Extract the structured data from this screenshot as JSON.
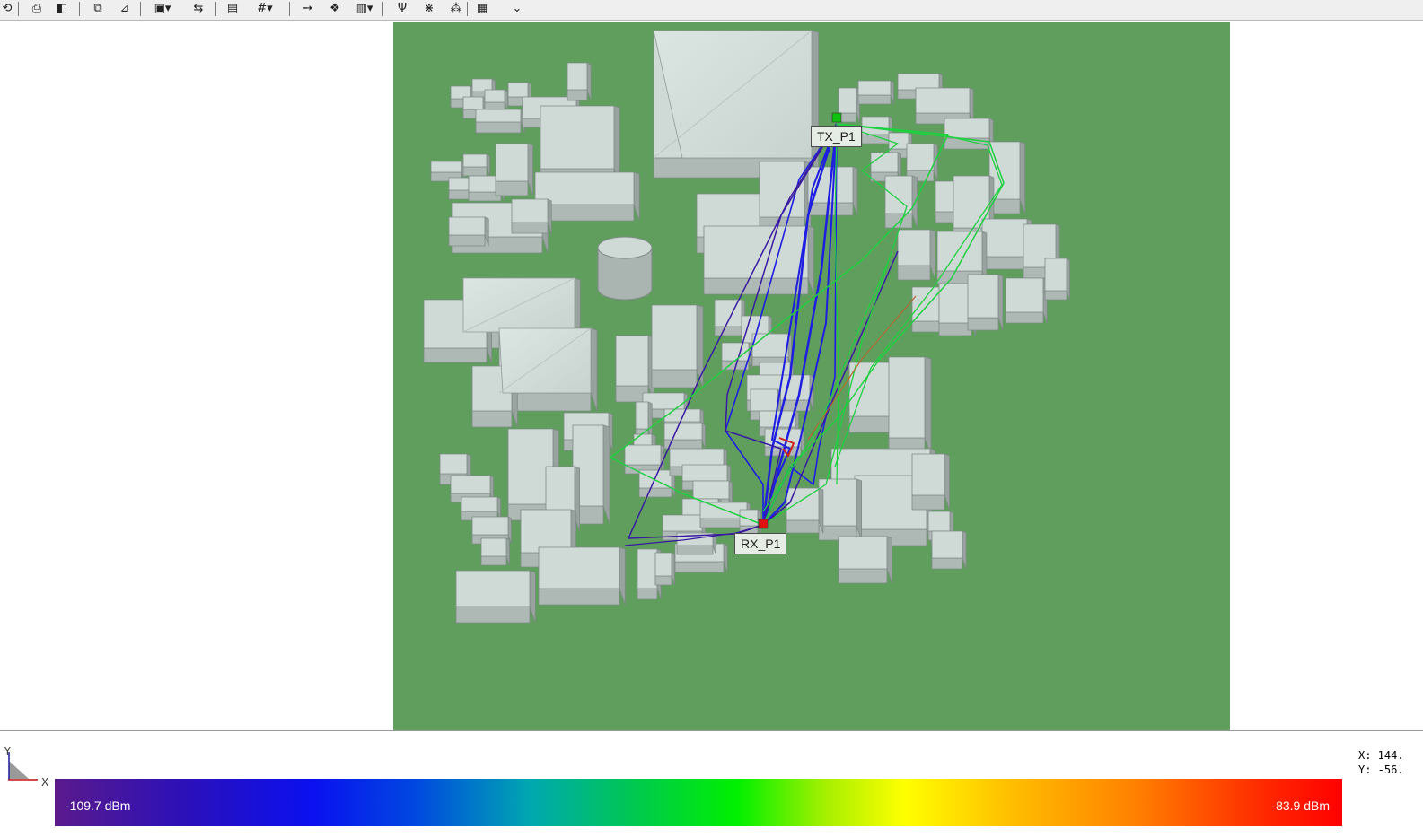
{
  "toolbar": {
    "buttons": [
      {
        "name": "rotate-view-icon",
        "glyph": "⟲"
      },
      {
        "name": "print-icon",
        "glyph": "⎙"
      },
      {
        "name": "solid-shading-icon",
        "glyph": "◧"
      },
      {
        "name": "copy-view-icon",
        "glyph": "⧉"
      },
      {
        "name": "edit-view-icon",
        "glyph": "⊿"
      },
      {
        "name": "capture-dropdown-icon",
        "glyph": "▣▾"
      },
      {
        "name": "view-history-icon",
        "glyph": "⇆"
      },
      {
        "name": "layers-icon",
        "glyph": "▤"
      },
      {
        "name": "grid-dropdown-icon",
        "glyph": "#▾"
      },
      {
        "name": "translate-icon",
        "glyph": "➙"
      },
      {
        "name": "orbit-icon",
        "glyph": "❖"
      },
      {
        "name": "chart-dropdown-icon",
        "glyph": "▥▾"
      },
      {
        "name": "ray-filter-icon",
        "glyph": "Ψ"
      },
      {
        "name": "ray-paths-icon",
        "glyph": "⋇"
      },
      {
        "name": "ray-spread-icon",
        "glyph": "⁂"
      },
      {
        "name": "render-mode-icon",
        "glyph": "▦"
      },
      {
        "name": "expand-toolbar-icon",
        "glyph": "⌄"
      }
    ]
  },
  "viewport": {
    "tx_label": "TX_P1",
    "rx_label": "RX_P1",
    "ground_color": "#5f9e5d",
    "building_color": "#cfd9d6"
  },
  "axis": {
    "x_label": "X",
    "y_label": "Y"
  },
  "coords": {
    "x_text": "X: 144.",
    "y_text": "Y: -56."
  },
  "legend": {
    "min_label": "-109.7 dBm",
    "max_label": "-83.9 dBm",
    "min_dbm": -109.7,
    "max_dbm": -83.9
  },
  "colors": {
    "ray_blue": "#1e1ee0",
    "ray_green": "#20d040",
    "ray_purple": "#3a1aa0",
    "tx_marker": "#10c010",
    "rx_marker": "#e01010"
  }
}
